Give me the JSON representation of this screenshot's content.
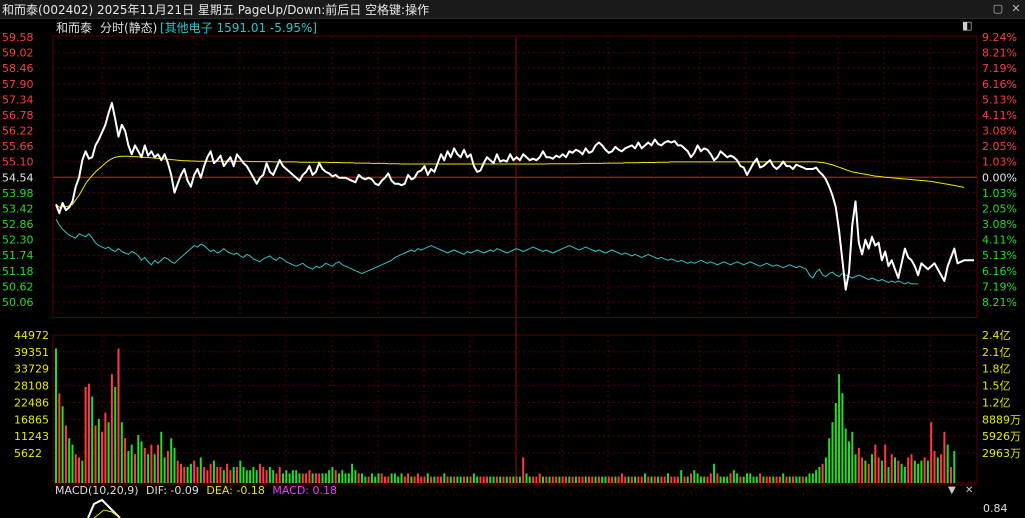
{
  "window": {
    "title": "和而泰(002402) 2025年11月21日 星期五 PageUp/Down:前后日 空格键:操作",
    "restore_glyph": "▢",
    "close_glyph": "✕"
  },
  "header": {
    "stock_name": "和而泰",
    "mode": "分时(静态)",
    "index_info": "[其他电子 1591.01 -5.95%]",
    "toggle_glyph": "◧"
  },
  "price_axis": {
    "left": [
      "59.58",
      "59.02",
      "58.46",
      "57.90",
      "57.34",
      "56.78",
      "56.22",
      "55.66",
      "55.10",
      "54.54",
      "53.98",
      "53.42",
      "52.86",
      "52.30",
      "51.74",
      "51.18",
      "50.62",
      "50.06"
    ],
    "right": [
      "9.24%",
      "8.21%",
      "7.19%",
      "6.16%",
      "5.13%",
      "4.11%",
      "3.08%",
      "2.05%",
      "1.03%",
      "0.00%",
      "1.03%",
      "2.05%",
      "3.08%",
      "4.11%",
      "5.13%",
      "6.16%",
      "7.19%",
      "8.21%"
    ],
    "prev_close": 54.54
  },
  "volume_axis": {
    "left": [
      "44972",
      "39351",
      "33729",
      "28108",
      "22486",
      "16865",
      "11243",
      "5622"
    ],
    "right": [
      "2.4亿",
      "2.1亿",
      "1.8亿",
      "1.5亿",
      "1.2亿",
      "8889万",
      "5926万",
      "2963万"
    ]
  },
  "macd": {
    "label": "MACD(10,20,9)",
    "dif_text": "DIF: -0.09",
    "dea_text": "DEA: -0.18",
    "macd_text": "MACD: 0.18",
    "right_value": "0.84",
    "down_glyph": "▼",
    "close_glyph": "✕"
  },
  "colors": {
    "grid": "#5a0000",
    "up": "#ff3b3b",
    "down": "#22dd22",
    "price_line": "#ffffff",
    "avg_line": "#e8e800",
    "index_line": "#2fc3c3",
    "teal_text": "#22c8c8",
    "yellow_text": "#e8e800",
    "magenta_text": "#ff33ff"
  },
  "chart_data": {
    "type": "line",
    "price": [
      53.9,
      53.6,
      53.95,
      53.7,
      53.8,
      54.0,
      54.5,
      54.8,
      55.4,
      55.7,
      55.45,
      55.5,
      55.9,
      56.1,
      56.35,
      56.6,
      57.0,
      57.34,
      56.8,
      56.2,
      56.6,
      56.4,
      55.9,
      55.6,
      55.9,
      55.7,
      55.5,
      55.9,
      55.55,
      55.7,
      55.5,
      55.6,
      55.4,
      55.6,
      55.3,
      54.9,
      54.3,
      54.6,
      54.9,
      55.1,
      54.7,
      54.5,
      54.9,
      55.1,
      54.8,
      55.2,
      55.5,
      55.7,
      55.3,
      55.4,
      55.55,
      55.2,
      55.35,
      55.5,
      55.2,
      55.6,
      55.45,
      55.3,
      55.2,
      55.0,
      54.8,
      54.6,
      54.8,
      54.9,
      55.3,
      55.0,
      54.9,
      55.15,
      55.4,
      55.2,
      55.1,
      55.0,
      54.9,
      54.8,
      54.7,
      54.9,
      55.0,
      55.2,
      54.9,
      55.0,
      55.3,
      55.1,
      55.0,
      54.95,
      54.85,
      54.9,
      54.8,
      54.8,
      54.8,
      54.75,
      54.7,
      54.65,
      54.9,
      54.8,
      54.75,
      54.8,
      54.75,
      54.6,
      54.55,
      54.7,
      54.8,
      54.95,
      54.7,
      54.6,
      54.6,
      54.55,
      54.6,
      54.9,
      54.75,
      54.8,
      55.0,
      55.05,
      55.2,
      54.9,
      55.1,
      55.0,
      55.3,
      55.6,
      55.4,
      55.7,
      55.5,
      55.8,
      55.6,
      55.5,
      55.75,
      55.5,
      55.6,
      55.2,
      55.0,
      55.05,
      55.3,
      55.5,
      55.4,
      55.3,
      55.6,
      55.35,
      55.4,
      55.35,
      55.6,
      55.4,
      55.5,
      55.4,
      55.6,
      55.5,
      55.4,
      55.45,
      55.4,
      55.5,
      55.7,
      55.5,
      55.5,
      55.45,
      55.55,
      55.5,
      55.6,
      55.5,
      55.7,
      55.65,
      55.75,
      55.7,
      55.6,
      55.8,
      55.65,
      55.7,
      55.9,
      56.0,
      55.9,
      55.75,
      55.65,
      55.7,
      55.85,
      55.75,
      55.7,
      55.8,
      55.85,
      55.9,
      55.8,
      56.0,
      55.8,
      55.9,
      56.0,
      55.9,
      56.1,
      55.95,
      55.9,
      56.0,
      56.05,
      56.0,
      56.05,
      55.9,
      55.9,
      55.8,
      55.7,
      55.5,
      55.65,
      55.9,
      55.7,
      55.8,
      55.75,
      55.6,
      55.4,
      55.5,
      55.7,
      55.6,
      55.5,
      55.55,
      55.5,
      55.4,
      55.2,
      55.15,
      54.9,
      55.1,
      55.3,
      55.45,
      55.15,
      55.2,
      55.3,
      55.4,
      55.2,
      55.1,
      55.2,
      55.35,
      55.2,
      55.2,
      55.1,
      55.25,
      55.2,
      55.15,
      55.1,
      55.1,
      55.1,
      55.15,
      55.0,
      54.9,
      54.75,
      54.5,
      54.2,
      53.8,
      53.0,
      52.0,
      51.0,
      51.6,
      53.2,
      54.0,
      52.6,
      52.2,
      52.7,
      52.4,
      52.8,
      52.5,
      52.6,
      52.0,
      52.3,
      51.8,
      52.0,
      51.7,
      51.4,
      51.9,
      52.4,
      52.1,
      52.0,
      51.8,
      51.5,
      51.9,
      51.8,
      51.7,
      51.8,
      51.9,
      51.7,
      51.5,
      51.3,
      51.8,
      52.1,
      52.4,
      51.9,
      51.95,
      52.0,
      52.0,
      52.0,
      52.0
    ],
    "avg_price": [
      53.9,
      53.8,
      53.82,
      53.82,
      53.85,
      53.9,
      54.05,
      54.2,
      54.4,
      54.6,
      54.75,
      54.88,
      55.0,
      55.1,
      55.2,
      55.3,
      55.38,
      55.45,
      55.5,
      55.52,
      55.53,
      55.53,
      55.53,
      55.52,
      55.52,
      55.51,
      55.5,
      55.5,
      55.49,
      55.48,
      55.47,
      55.46,
      55.45,
      55.44,
      55.43,
      55.42,
      55.41,
      55.4,
      55.39,
      55.38,
      55.38,
      55.37,
      55.37,
      55.36,
      55.36,
      55.36,
      55.36,
      55.36,
      55.36,
      55.36,
      55.36,
      55.36,
      55.36,
      55.36,
      55.36,
      55.36,
      55.36,
      55.36,
      55.36,
      55.35,
      55.35,
      55.35,
      55.35,
      55.35,
      55.35,
      55.35,
      55.34,
      55.34,
      55.34,
      55.34,
      55.34,
      55.34,
      55.34,
      55.34,
      55.33,
      55.33,
      55.33,
      55.33,
      55.33,
      55.33,
      55.33,
      55.33,
      55.33,
      55.32,
      55.32,
      55.32,
      55.32,
      55.31,
      55.31,
      55.31,
      55.31,
      55.3,
      55.3,
      55.3,
      55.3,
      55.3,
      55.29,
      55.29,
      55.29,
      55.29,
      55.29,
      55.28,
      55.28,
      55.28,
      55.28,
      55.27,
      55.27,
      55.27,
      55.27,
      55.27,
      55.27,
      55.27,
      55.27,
      55.27,
      55.27,
      55.27,
      55.27,
      55.27,
      55.27,
      55.27,
      55.27,
      55.27,
      55.27,
      55.27,
      55.27,
      55.27,
      55.27,
      55.27,
      55.27,
      55.27,
      55.27,
      55.27,
      55.27,
      55.27,
      55.27,
      55.27,
      55.27,
      55.27,
      55.27,
      55.27,
      55.27,
      55.27,
      55.27,
      55.27,
      55.27,
      55.27,
      55.27,
      55.27,
      55.27,
      55.27,
      55.28,
      55.28,
      55.28,
      55.28,
      55.28,
      55.28,
      55.28,
      55.28,
      55.28,
      55.28,
      55.29,
      55.29,
      55.29,
      55.29,
      55.29,
      55.29,
      55.29,
      55.3,
      55.3,
      55.3,
      55.3,
      55.3,
      55.3,
      55.31,
      55.31,
      55.31,
      55.31,
      55.31,
      55.32,
      55.32,
      55.32,
      55.32,
      55.32,
      55.33,
      55.33,
      55.33,
      55.33,
      55.34,
      55.34,
      55.34,
      55.34,
      55.34,
      55.34,
      55.34,
      55.34,
      55.34,
      55.34,
      55.34,
      55.34,
      55.34,
      55.34,
      55.34,
      55.34,
      55.34,
      55.34,
      55.34,
      55.34,
      55.34,
      55.34,
      55.34,
      55.34,
      55.34,
      55.34,
      55.34,
      55.34,
      55.34,
      55.34,
      55.34,
      55.34,
      55.34,
      55.34,
      55.34,
      55.34,
      55.34,
      55.34,
      55.34,
      55.34,
      55.34,
      55.34,
      55.34,
      55.34,
      55.34,
      55.33,
      55.32,
      55.3,
      55.27,
      55.24,
      55.2,
      55.16,
      55.12,
      55.08,
      55.04,
      55.0,
      54.98,
      54.96,
      54.94,
      54.92,
      54.9,
      54.88,
      54.86,
      54.85,
      54.84,
      54.82,
      54.81,
      54.8,
      54.79,
      54.78,
      54.77,
      54.76,
      54.75,
      54.74,
      54.73,
      54.72,
      54.71,
      54.7,
      54.69,
      54.68,
      54.66,
      54.64,
      54.62,
      54.6,
      54.58,
      54.56,
      54.54,
      54.52,
      54.5,
      54.48
    ],
    "index_price": [
      53.4,
      53.2,
      53.05,
      52.95,
      52.85,
      52.8,
      52.75,
      52.9,
      52.85,
      52.8,
      52.9,
      52.75,
      52.6,
      52.5,
      52.45,
      52.4,
      52.45,
      52.35,
      52.3,
      52.4,
      52.3,
      52.25,
      52.2,
      52.3,
      52.25,
      52.15,
      52.0,
      52.1,
      51.95,
      51.85,
      52.0,
      51.9,
      52.0,
      52.1,
      52.05,
      51.95,
      51.9,
      52.0,
      52.1,
      52.2,
      52.3,
      52.4,
      52.5,
      52.45,
      52.55,
      52.5,
      52.4,
      52.3,
      52.35,
      52.25,
      52.3,
      52.4,
      52.3,
      52.25,
      52.2,
      52.25,
      52.15,
      52.1,
      52.2,
      52.15,
      52.05,
      52.0,
      51.95,
      52.05,
      52.1,
      52.15,
      52.05,
      52.0,
      52.1,
      52.05,
      51.95,
      51.9,
      51.85,
      51.8,
      51.85,
      51.9,
      51.8,
      51.75,
      51.7,
      51.8,
      51.75,
      51.8,
      51.9,
      51.85,
      51.8,
      51.9,
      51.95,
      51.85,
      51.8,
      51.75,
      51.7,
      51.65,
      51.6,
      51.55,
      51.6,
      51.65,
      51.7,
      51.75,
      51.8,
      51.85,
      51.9,
      51.95,
      52.0,
      52.1,
      52.15,
      52.2,
      52.25,
      52.3,
      52.35,
      52.3,
      52.4,
      52.35,
      52.4,
      52.45,
      52.5,
      52.45,
      52.4,
      52.35,
      52.3,
      52.25,
      52.3,
      52.35,
      52.3,
      52.25,
      52.2,
      52.3,
      52.25,
      52.3,
      52.35,
      52.3,
      52.25,
      52.3,
      52.35,
      52.3,
      52.4,
      52.35,
      52.3,
      52.25,
      52.3,
      52.35,
      52.4,
      52.35,
      52.3,
      52.35,
      52.4,
      52.45,
      52.4,
      52.35,
      52.3,
      52.35,
      52.3,
      52.25,
      52.3,
      52.35,
      52.4,
      52.45,
      52.5,
      52.45,
      52.4,
      52.35,
      52.4,
      52.45,
      52.4,
      52.35,
      52.3,
      52.35,
      52.3,
      52.25,
      52.3,
      52.35,
      52.3,
      52.25,
      52.2,
      52.25,
      52.2,
      52.15,
      52.2,
      52.15,
      52.1,
      52.15,
      52.2,
      52.15,
      52.1,
      52.05,
      52.1,
      52.05,
      52.0,
      52.05,
      52.0,
      51.95,
      52.0,
      51.95,
      51.9,
      51.95,
      51.9,
      51.95,
      52.0,
      51.95,
      51.9,
      51.95,
      51.9,
      51.85,
      51.9,
      51.95,
      51.9,
      51.85,
      51.9,
      51.95,
      51.9,
      51.85,
      51.9,
      51.95,
      51.9,
      51.85,
      51.8,
      51.85,
      51.9,
      51.85,
      51.8,
      51.85,
      51.8,
      51.75,
      51.8,
      51.85,
      51.8,
      51.75,
      51.8,
      51.75,
      51.7,
      51.5,
      51.4,
      51.6,
      51.7,
      51.5,
      51.45,
      51.55,
      51.6,
      51.5,
      51.45,
      51.55,
      51.5,
      51.45,
      51.4,
      51.45,
      51.5,
      51.45,
      51.4,
      51.35,
      51.4,
      51.35,
      51.3,
      51.35,
      51.3,
      51.25,
      51.3,
      51.25,
      51.3,
      51.25,
      51.2,
      51.25,
      51.2,
      51.2,
      51.2
    ],
    "volume": [
      42000,
      28000,
      24000,
      18000,
      14000,
      12000,
      9000,
      8000,
      7000,
      30000,
      31000,
      27000,
      18000,
      20000,
      16000,
      22000,
      19000,
      34000,
      30000,
      42000,
      19000,
      14000,
      10000,
      12000,
      9000,
      15000,
      13000,
      11000,
      9000,
      12000,
      9000,
      12000,
      16000,
      8000,
      10000,
      14000,
      11000,
      7000,
      6000,
      5000,
      5000,
      6000,
      7000,
      5000,
      8000,
      5000,
      4000,
      6000,
      7000,
      5000,
      5000,
      4000,
      6000,
      4000,
      5000,
      5000,
      7000,
      5000,
      4000,
      4000,
      5000,
      4000,
      6000,
      5000,
      4000,
      5000,
      4000,
      3000,
      5000,
      3000,
      4000,
      3000,
      4000,
      4000,
      3000,
      3000,
      3000,
      4000,
      3000,
      3000,
      3000,
      3000,
      3000,
      4000,
      5000,
      4000,
      3000,
      4000,
      3000,
      3000,
      6000,
      4000,
      3000,
      3000,
      2000,
      2000,
      3000,
      2000,
      3000,
      3000,
      2000,
      2000,
      3000,
      3000,
      2000,
      3000,
      2000,
      3000,
      2000,
      2000,
      3000,
      2000,
      2000,
      3000,
      2000,
      2000,
      2000,
      2000,
      3000,
      2000,
      2000,
      2000,
      2000,
      2000,
      2000,
      2000,
      2000,
      3000,
      2000,
      2000,
      2000,
      2000,
      2000,
      2000,
      2000,
      2000,
      2000,
      2000,
      2000,
      2000,
      2000,
      2000,
      8000,
      3000,
      2000,
      2000,
      2000,
      3000,
      2000,
      2000,
      2000,
      2000,
      2000,
      2000,
      2000,
      2000,
      2000,
      2000,
      2000,
      2000,
      2000,
      2000,
      2000,
      2000,
      2000,
      2000,
      2000,
      2000,
      2000,
      2000,
      2000,
      2000,
      3000,
      2000,
      2000,
      2000,
      2000,
      2000,
      2000,
      3000,
      2000,
      2000,
      2000,
      2000,
      2000,
      2000,
      3000,
      2000,
      2000,
      2000,
      4000,
      2000,
      2000,
      3000,
      4000,
      3000,
      2000,
      2000,
      2000,
      3000,
      6000,
      3000,
      2000,
      2000,
      2000,
      3000,
      4000,
      3000,
      2000,
      2000,
      3000,
      3000,
      2000,
      2000,
      3000,
      2000,
      2000,
      2000,
      2000,
      2000,
      2000,
      3000,
      2000,
      2000,
      2000,
      2000,
      2000,
      2000,
      2000,
      3000,
      3000,
      4000,
      5000,
      6000,
      8000,
      14000,
      19000,
      25000,
      34000,
      28000,
      17000,
      13000,
      16000,
      9000,
      11000,
      8000,
      7000,
      6000,
      9000,
      12000,
      8000,
      7000,
      12000,
      5000,
      9000,
      8000,
      7000,
      6000,
      5000,
      8000,
      9000,
      7000,
      6000,
      7000,
      8000,
      7000,
      19000,
      10000,
      8000,
      9000,
      16000,
      12000,
      5000,
      10000
    ],
    "vol_up": [
      0,
      1,
      0,
      1,
      0,
      0,
      1,
      1,
      0,
      1,
      1,
      0,
      1,
      0,
      1,
      1,
      0,
      1,
      0,
      1,
      0,
      1,
      0,
      0,
      1,
      0,
      0,
      1,
      0,
      1,
      0,
      1,
      0,
      0,
      1,
      0,
      0,
      1,
      1,
      1,
      0,
      0,
      1,
      1,
      0,
      1,
      1,
      1,
      0,
      1,
      1,
      0,
      1,
      1,
      0,
      1,
      0,
      0,
      0,
      0,
      0,
      0,
      1,
      1,
      1,
      0,
      0,
      1,
      1,
      0,
      0,
      0,
      0,
      0,
      0,
      1,
      1,
      1,
      0,
      1,
      1,
      0,
      0,
      0,
      0,
      1,
      0,
      0,
      0,
      0,
      0,
      0,
      1,
      0,
      0,
      1,
      0,
      0,
      0,
      1,
      1,
      1,
      0,
      0,
      0,
      0,
      1,
      1,
      0,
      1,
      1,
      1,
      1,
      0,
      1,
      0,
      1,
      1,
      0,
      1,
      0,
      1,
      0,
      0,
      1,
      0,
      1,
      0,
      0,
      1,
      1,
      1,
      0,
      0,
      1,
      0,
      1,
      0,
      1,
      0,
      1,
      0,
      1,
      0,
      0,
      1,
      1,
      1,
      0,
      1,
      0,
      1,
      1,
      0,
      1,
      1,
      0,
      1,
      0,
      1,
      1,
      0,
      1,
      1,
      0,
      1,
      0,
      0,
      1,
      1,
      0,
      1,
      1,
      1,
      0,
      1,
      0,
      1,
      1,
      0,
      1,
      0,
      1,
      0,
      1,
      1,
      0,
      1,
      1,
      1,
      0,
      1,
      0,
      1,
      0,
      0,
      0,
      0,
      1,
      1,
      0,
      1,
      0,
      0,
      0,
      1,
      0,
      0,
      1,
      0,
      0,
      0,
      0,
      0,
      1,
      0,
      1,
      1,
      0,
      1,
      1,
      0,
      1,
      0,
      1,
      0,
      0,
      1,
      0,
      0,
      0,
      0,
      0,
      1,
      0,
      0,
      0,
      0,
      0,
      0,
      0,
      0,
      0,
      0,
      1,
      1,
      0,
      1,
      0,
      1,
      1,
      0,
      1,
      0,
      1,
      0,
      1,
      0,
      0,
      1,
      1,
      0,
      0,
      0,
      1,
      0,
      1,
      1,
      0,
      1,
      1,
      0,
      1,
      0,
      0,
      1,
      1,
      1,
      0,
      1
    ],
    "ylim": [
      50.06,
      59.58
    ],
    "vol_max": 44972
  }
}
